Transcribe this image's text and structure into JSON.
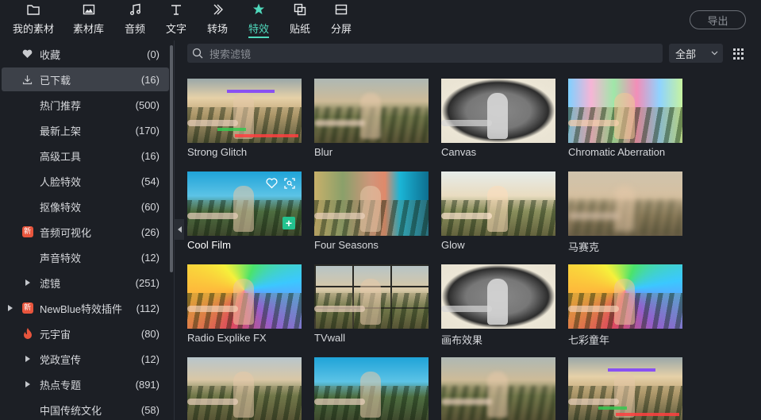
{
  "topbar": {
    "tabs": [
      {
        "label": "我的素材",
        "icon": "folder-icon"
      },
      {
        "label": "素材库",
        "icon": "image-library-icon"
      },
      {
        "label": "音频",
        "icon": "music-note-icon"
      },
      {
        "label": "文字",
        "icon": "text-icon"
      },
      {
        "label": "转场",
        "icon": "transition-icon"
      },
      {
        "label": "特效",
        "icon": "effects-star-icon"
      },
      {
        "label": "贴纸",
        "icon": "sticker-icon"
      },
      {
        "label": "分屏",
        "icon": "split-screen-icon"
      }
    ],
    "active_tab": "特效",
    "export_label": "导出"
  },
  "sidebar": {
    "items": [
      {
        "label": "收藏",
        "count": "(0)",
        "icon": "heart-icon"
      },
      {
        "label": "已下载",
        "count": "(16)",
        "icon": "download-icon",
        "active": true
      },
      {
        "label": "热门推荐",
        "count": "(500)"
      },
      {
        "label": "最新上架",
        "count": "(170)"
      },
      {
        "label": "高级工具",
        "count": "(16)"
      },
      {
        "label": "人脸特效",
        "count": "(54)"
      },
      {
        "label": "抠像特效",
        "count": "(60)"
      },
      {
        "label": "音频可视化",
        "count": "(26)",
        "icon": "new-badge-icon",
        "badge": "新"
      },
      {
        "label": "声音特效",
        "count": "(12)"
      },
      {
        "label": "滤镜",
        "count": "(251)",
        "icon": "expand-arrow-icon"
      },
      {
        "label": "NewBlue特效插件",
        "count": "(112)",
        "icon": "new-badge-icon",
        "badge": "新",
        "expandable": true
      },
      {
        "label": "元宇宙",
        "count": "(80)",
        "icon": "fire-icon"
      },
      {
        "label": "党政宣传",
        "count": "(12)",
        "icon": "expand-arrow-icon"
      },
      {
        "label": "热点专题",
        "count": "(891)",
        "icon": "expand-arrow-icon"
      },
      {
        "label": "中国传统文化",
        "count": "(58)"
      }
    ]
  },
  "search": {
    "placeholder": "搜索滤镜"
  },
  "filter": {
    "selected": "全部"
  },
  "effects": [
    {
      "name": "Strong Glitch",
      "style": "glitch"
    },
    {
      "name": "Blur",
      "style": "blur"
    },
    {
      "name": "Canvas",
      "style": "canvas"
    },
    {
      "name": "Chromatic Aberration",
      "style": "chromatic"
    },
    {
      "name": "Cool Film",
      "style": "cool",
      "hovered": true
    },
    {
      "name": "Four Seasons",
      "style": "seasons"
    },
    {
      "name": "Glow",
      "style": "glow"
    },
    {
      "name": "马赛克",
      "style": "mosaic"
    },
    {
      "name": "Radio Explike FX",
      "style": "rainbow"
    },
    {
      "name": "TVwall",
      "style": "tvwall"
    },
    {
      "name": "画布效果",
      "style": "canvas"
    },
    {
      "name": "七彩童年",
      "style": "rainbow"
    },
    {
      "name": "",
      "style": "normal"
    },
    {
      "name": "",
      "style": "cool"
    },
    {
      "name": "",
      "style": "blur"
    },
    {
      "name": "",
      "style": "glitch"
    }
  ],
  "colors": {
    "accent": "#4fd9bc",
    "background": "#1c1f25",
    "active_item": "#3d4149",
    "new_badge": "#e8553d",
    "add_button": "#23c28f"
  }
}
